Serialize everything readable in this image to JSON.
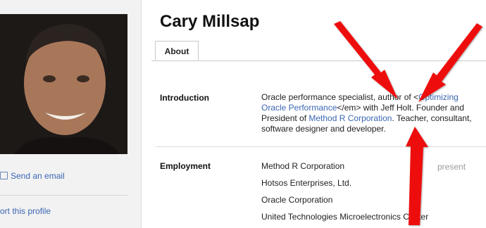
{
  "sidebar": {
    "send_email": "Send an email",
    "report_profile": "ort this profile"
  },
  "profile": {
    "name": "Cary Millsap",
    "tab_about": "About"
  },
  "introduction": {
    "label": "Introduction",
    "text_1": "Oracle performance specialist, author of <",
    "book_part_1": "Optimizing",
    "book_part_2": "Oracle Performance",
    "text_2": "</em> with Jeff Holt. Founder and President of ",
    "company_link": "Method R Corporation",
    "text_3": ". Teacher, consultant, software designer and developer."
  },
  "employment": {
    "label": "Employment",
    "present_label": "present",
    "items": [
      "Method R Corporation",
      "Hotsos Enterprises, Ltd.",
      "Oracle Corporation",
      "United Technologies Microelectronics Center"
    ]
  },
  "colors": {
    "link": "#3b66b3",
    "annotation_arrow": "#ee1111"
  }
}
